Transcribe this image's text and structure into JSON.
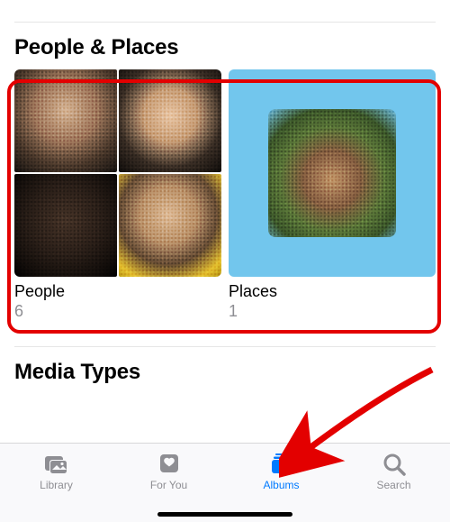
{
  "sections": {
    "people_places": {
      "title": "People & Places",
      "albums": [
        {
          "name": "People",
          "count": "6"
        },
        {
          "name": "Places",
          "count": "1"
        }
      ]
    },
    "media_types": {
      "title": "Media Types"
    }
  },
  "tabbar": {
    "items": [
      {
        "label": "Library",
        "active": false
      },
      {
        "label": "For You",
        "active": false
      },
      {
        "label": "Albums",
        "active": true
      },
      {
        "label": "Search",
        "active": false
      }
    ]
  }
}
